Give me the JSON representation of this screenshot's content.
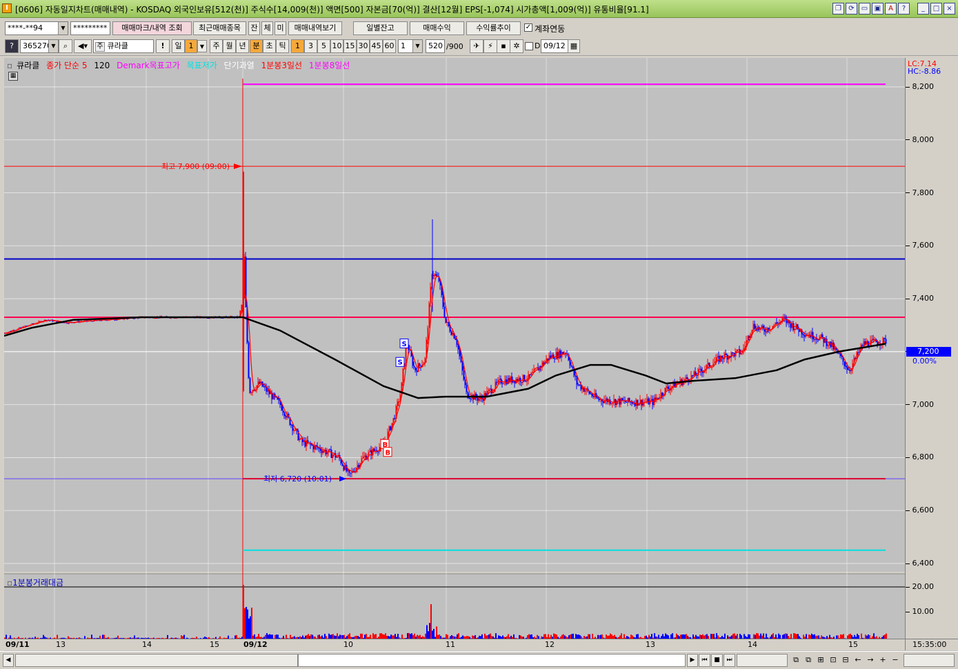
{
  "window": {
    "title": "[0606] 자동일지차트(매매내역) - KOSDAQ 외국인보유[512(천)] 주식수[14,009(천)] 액면[500] 자본금[70(억)] 결산[12월] EPS[-1,074] 시가총액[1,009(억)] 유통비율[91.1]",
    "app_icon": "I",
    "controls": [
      "❐",
      "⟳",
      "▭",
      "▣",
      "A",
      "?",
      "_",
      "□",
      "×"
    ]
  },
  "toolbar1": {
    "account_value": "****-**94",
    "password_value": "*********",
    "btn_marks": "매매마크/내역 조회",
    "btn_recent": "최근매매종목",
    "btn_jan": "잔",
    "btn_che": "체",
    "btn_mi": "미",
    "btn_history": "매매내역보기",
    "btn_daily_balance": "일별잔고",
    "btn_trade_profit": "매매수익",
    "btn_yield_trend": "수익률추이",
    "account_link_checkbox": "계좌연동",
    "account_link_checked": true
  },
  "toolbar2": {
    "help_icon": "?",
    "code": "365270",
    "stock_name_prefix": "주",
    "stock_name": "큐라클",
    "exclaim": "!",
    "period_day": "일",
    "period_day_value": "1",
    "period_week": "주",
    "period_month": "월",
    "period_year": "년",
    "period_minute": "분",
    "period_second": "초",
    "period_tick": "틱",
    "minute_options": [
      "1",
      "3",
      "5",
      "10",
      "15",
      "30",
      "45",
      "60"
    ],
    "minute_selected": "1",
    "count_value": "1",
    "display_count": "520",
    "display_total": "/900",
    "date_checkbox_label": "D",
    "date_value": "09/12"
  },
  "legend": {
    "name": "큐라클",
    "ma_label": "종가 단순 5",
    "ma_120": "120",
    "demark": "Demark목표고가",
    "target": "목표저가",
    "short_overheat": "단기과열",
    "line3": "1분봉3일선",
    "line8": "1분봉8일선"
  },
  "price_panel": {
    "lc": "LC:7.14",
    "hc": "HC:-8.86",
    "y_ticks": [
      "8,200",
      "8,000",
      "7,800",
      "7,600",
      "7,400",
      "7,200",
      "7,000",
      "6,800",
      "6,600",
      "6,400"
    ],
    "current_price": "7,200",
    "current_pct": "0.00%",
    "high_label": "최고 7,900 (09:00)",
    "low_label": "최저 6,720 (10:01)",
    "markers": [
      "S",
      "S",
      "B",
      "B"
    ]
  },
  "volume_panel": {
    "title": "1분봉거래대금",
    "y_ticks": [
      "20.00",
      "10.00"
    ]
  },
  "x_axis": {
    "labels": [
      "09/11",
      "13",
      "14",
      "15",
      "09/12",
      "10",
      "11",
      "12",
      "13",
      "14",
      "15"
    ],
    "time": "15:35:00"
  },
  "colors": {
    "up": "#ff0000",
    "down": "#0000ff",
    "ma120": "#000000",
    "demark": "#ff00ff",
    "target": "#00e0e0",
    "blue_line": "#0000c8",
    "red_line": "#ff0000"
  }
}
